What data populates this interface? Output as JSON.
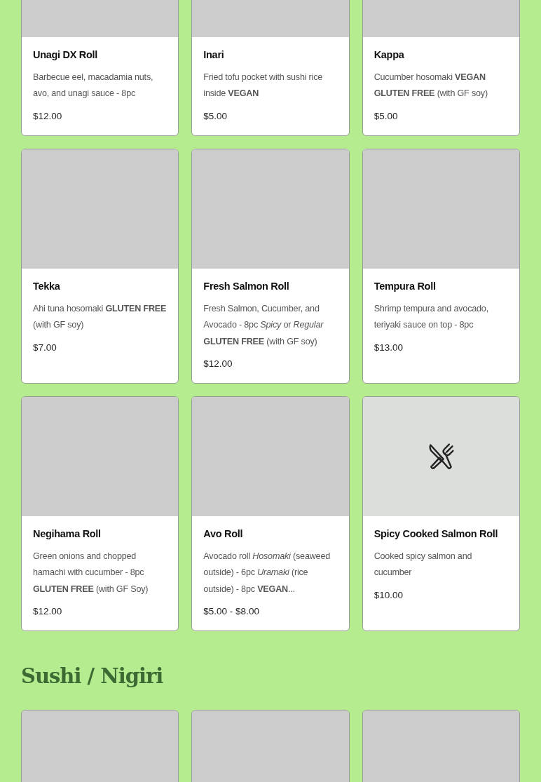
{
  "items": [
    {
      "kind": "blank",
      "name": "Unagi DX Roll",
      "description": "Barbecue eel, macadamia nuts, avo, and unagi sauce - 8pc",
      "price": "$12.00"
    },
    {
      "kind": "blank",
      "name": "Inari",
      "description": "Fried tofu pocket with sushi rice inside **VEGAN**",
      "price": "$5.00"
    },
    {
      "kind": "blank",
      "name": "Kappa",
      "description": "Cucumber hosomaki **VEGAN** **GLUTEN FREE** (with GF soy)",
      "price": "$5.00"
    },
    {
      "kind": "blank",
      "name": "Tekka",
      "description": "Ahi tuna hosomaki **GLUTEN FREE** (with GF soy)",
      "price": "$7.00"
    },
    {
      "kind": "blank",
      "name": "Fresh Salmon Roll",
      "description": "Fresh Salmon, Cucumber, and Avocado - 8pc *Spicy* or *Regular* **GLUTEN FREE** (with GF soy)",
      "price": "$12.00"
    },
    {
      "kind": "blank",
      "name": "Tempura Roll",
      "description": "Shrimp tempura and avocado, teriyaki sauce on top - 8pc",
      "price": "$13.00"
    },
    {
      "kind": "blank",
      "name": "Negihama Roll",
      "description": "Green onions and chopped hamachi with cucumber - 8pc **GLUTEN FREE** (with GF Soy)",
      "price": "$12.00"
    },
    {
      "kind": "blank",
      "name": "Avo Roll",
      "description": "Avocado roll *Hosomaki* (seaweed outside) - 6pc *Uramaki* (rice outside) - 8pc **VEGAN**...",
      "price": "$5.00 - $8.00"
    },
    {
      "kind": "placeholder",
      "name": "Spicy Cooked Salmon Roll",
      "description": "Cooked spicy salmon and cucumber",
      "price": "$10.00"
    }
  ],
  "section": {
    "heading": "Sushi / Nigiri",
    "items": [
      {
        "kind": "blank"
      },
      {
        "kind": "blank"
      },
      {
        "kind": "blank"
      }
    ]
  }
}
